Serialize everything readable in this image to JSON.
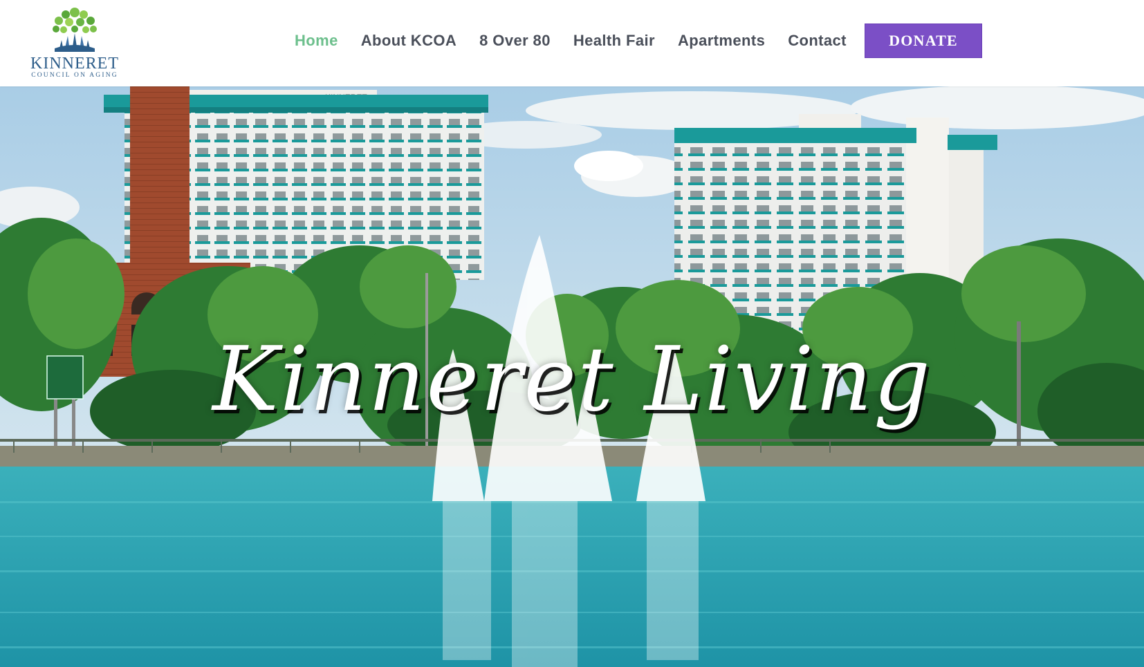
{
  "logo": {
    "name": "KINNERET",
    "subtitle": "COUNCIL ON AGING"
  },
  "nav": {
    "items": [
      {
        "label": "Home",
        "active": true
      },
      {
        "label": "About KCOA",
        "active": false
      },
      {
        "label": "8 Over 80",
        "active": false
      },
      {
        "label": "Health Fair",
        "active": false
      },
      {
        "label": "Apartments",
        "active": false
      },
      {
        "label": "Contact",
        "active": false
      }
    ],
    "donate_label": "DONATE"
  },
  "hero": {
    "title": "Kinneret Living",
    "building_sign": "KINNERET"
  },
  "colors": {
    "nav_active": "#6cbf8c",
    "nav_text": "#4a4f5a",
    "donate_bg": "#7b4fc6",
    "logo_blue": "#2d5d8a",
    "logo_green": "#7cc04a",
    "water": "#2a9fb0",
    "building_trim": "#1a9a9a"
  }
}
